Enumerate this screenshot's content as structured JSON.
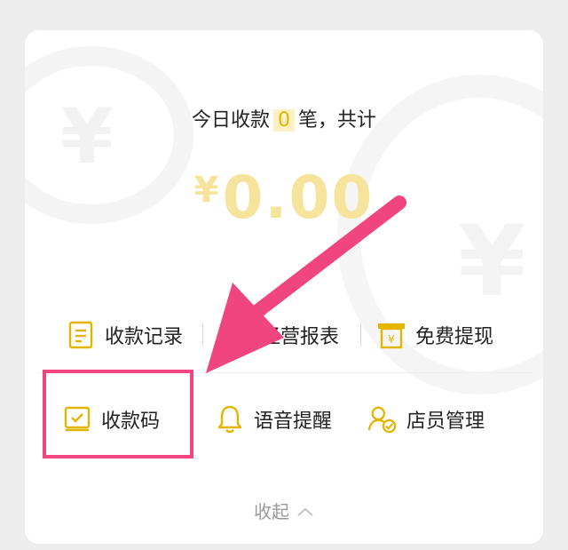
{
  "summary": {
    "prefix": "今日收款",
    "count": "0",
    "suffix": "笔，共计"
  },
  "amount": {
    "currency": "¥",
    "value": "0.00"
  },
  "actions_row1": [
    {
      "label": "收款记录",
      "icon": "document-icon"
    },
    {
      "label": "经营报表",
      "icon": "report-icon"
    },
    {
      "label": "免费提现",
      "icon": "withdraw-icon"
    }
  ],
  "actions_row2": [
    {
      "label": "收款码",
      "icon": "qr-code-icon"
    },
    {
      "label": "语音提醒",
      "icon": "bell-icon"
    },
    {
      "label": "店员管理",
      "icon": "staff-icon"
    }
  ],
  "collapse_label": "收起",
  "colors": {
    "accent": "#e5b400",
    "amount": "#f6e39c",
    "annotation": "#f0457f"
  }
}
